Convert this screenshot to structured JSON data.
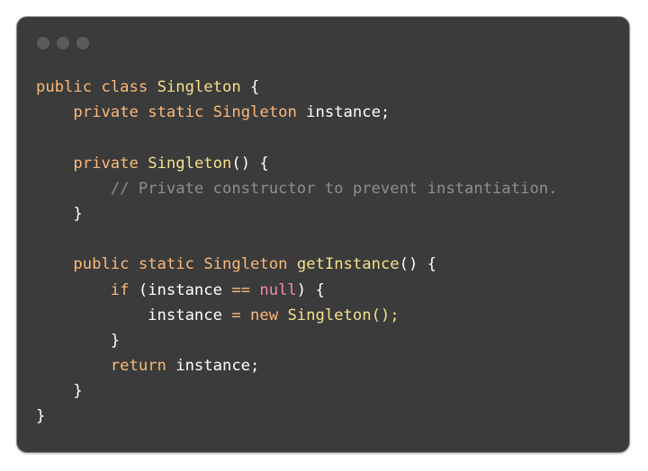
{
  "colors": {
    "background": "#3b3b3b",
    "keyword": "#f9b97a",
    "type": "#f5e08c",
    "plain": "#ffffff",
    "comment": "#8e8e8e",
    "null_literal": "#f08ab0"
  },
  "code": {
    "lines": [
      [
        {
          "t": "public",
          "k": "kw"
        },
        {
          "t": " ",
          "k": "plain"
        },
        {
          "t": "class",
          "k": "kw"
        },
        {
          "t": " ",
          "k": "plain"
        },
        {
          "t": "Singleton",
          "k": "type"
        },
        {
          "t": " {",
          "k": "plain"
        }
      ],
      [
        {
          "t": "    ",
          "k": "plain"
        },
        {
          "t": "private",
          "k": "kw"
        },
        {
          "t": " ",
          "k": "plain"
        },
        {
          "t": "static",
          "k": "kw"
        },
        {
          "t": " ",
          "k": "plain"
        },
        {
          "t": "Singleton",
          "k": "kw"
        },
        {
          "t": " instance;",
          "k": "plain"
        }
      ],
      [],
      [
        {
          "t": "    ",
          "k": "plain"
        },
        {
          "t": "private",
          "k": "kw"
        },
        {
          "t": " ",
          "k": "plain"
        },
        {
          "t": "Singleton",
          "k": "type"
        },
        {
          "t": "() {",
          "k": "plain"
        }
      ],
      [
        {
          "t": "        ",
          "k": "plain"
        },
        {
          "t": "// Private constructor to prevent instantiation.",
          "k": "comment"
        }
      ],
      [
        {
          "t": "    }",
          "k": "plain"
        }
      ],
      [],
      [
        {
          "t": "    ",
          "k": "plain"
        },
        {
          "t": "public",
          "k": "kw"
        },
        {
          "t": " ",
          "k": "plain"
        },
        {
          "t": "static",
          "k": "kw"
        },
        {
          "t": " ",
          "k": "plain"
        },
        {
          "t": "Singleton",
          "k": "kw"
        },
        {
          "t": " ",
          "k": "plain"
        },
        {
          "t": "getInstance",
          "k": "type"
        },
        {
          "t": "() {",
          "k": "plain"
        }
      ],
      [
        {
          "t": "        ",
          "k": "plain"
        },
        {
          "t": "if",
          "k": "kw"
        },
        {
          "t": " (instance ",
          "k": "plain"
        },
        {
          "t": "==",
          "k": "op"
        },
        {
          "t": " ",
          "k": "plain"
        },
        {
          "t": "null",
          "k": "null"
        },
        {
          "t": ") {",
          "k": "plain"
        }
      ],
      [
        {
          "t": "            instance ",
          "k": "plain"
        },
        {
          "t": "=",
          "k": "op"
        },
        {
          "t": " ",
          "k": "plain"
        },
        {
          "t": "new",
          "k": "kw"
        },
        {
          "t": " ",
          "k": "plain"
        },
        {
          "t": "Singleton",
          "k": "type"
        },
        {
          "t": "();",
          "k": "type"
        }
      ],
      [
        {
          "t": "        }",
          "k": "plain"
        }
      ],
      [
        {
          "t": "        ",
          "k": "plain"
        },
        {
          "t": "return",
          "k": "kw"
        },
        {
          "t": " instance;",
          "k": "plain"
        }
      ],
      [
        {
          "t": "    }",
          "k": "plain"
        }
      ],
      [
        {
          "t": "}",
          "k": "plain"
        }
      ]
    ]
  }
}
